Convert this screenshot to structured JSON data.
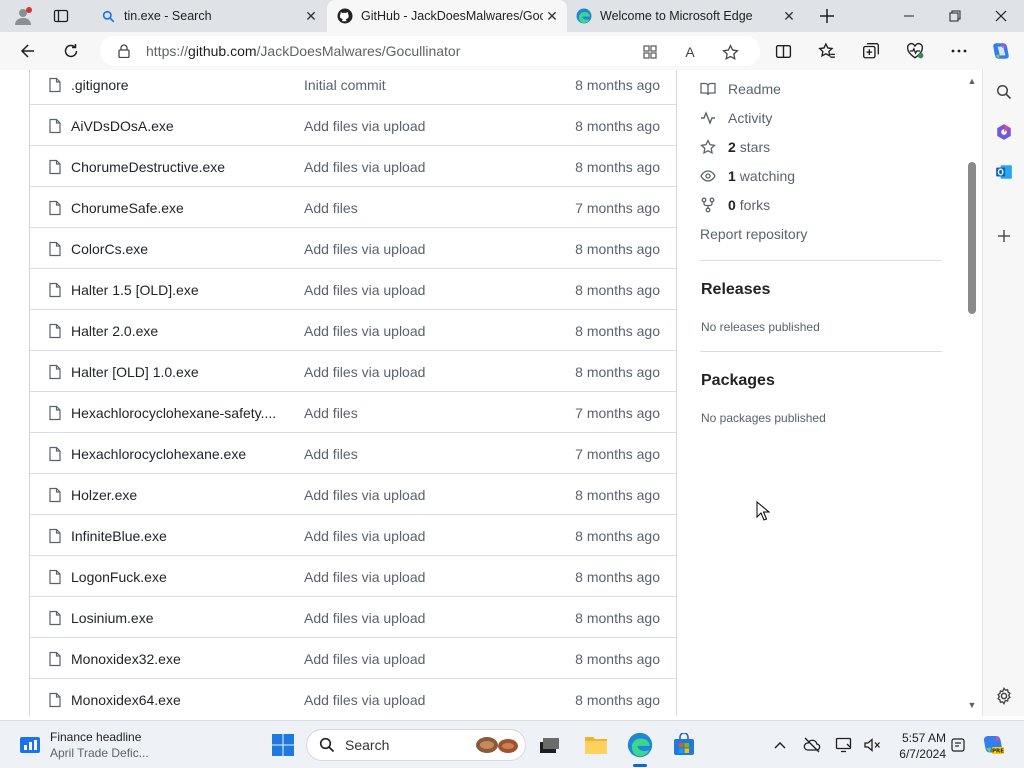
{
  "browser": {
    "tabs": [
      {
        "title": "tin.exe - Search",
        "icon": "search-icon",
        "active": false
      },
      {
        "title": "GitHub - JackDoesMalwares/Goc",
        "icon": "github-icon",
        "active": true
      },
      {
        "title": "Welcome to Microsoft Edge",
        "icon": "edge-icon",
        "active": false
      }
    ],
    "url_prefix": "https://",
    "url_host": "github.com",
    "url_path": "/JackDoesMalwares/Gocullinator",
    "read_aloud_label": "A"
  },
  "files": [
    {
      "name": ".gitignore",
      "message": "Initial commit",
      "date": "8 months ago"
    },
    {
      "name": "AiVDsDOsA.exe",
      "message": "Add files via upload",
      "date": "8 months ago"
    },
    {
      "name": "ChorumeDestructive.exe",
      "message": "Add files via upload",
      "date": "8 months ago"
    },
    {
      "name": "ChorumeSafe.exe",
      "message": "Add files",
      "date": "7 months ago"
    },
    {
      "name": "ColorCs.exe",
      "message": "Add files via upload",
      "date": "8 months ago"
    },
    {
      "name": "Halter 1.5 [OLD].exe",
      "message": "Add files via upload",
      "date": "8 months ago"
    },
    {
      "name": "Halter 2.0.exe",
      "message": "Add files via upload",
      "date": "8 months ago"
    },
    {
      "name": "Halter [OLD] 1.0.exe",
      "message": "Add files via upload",
      "date": "8 months ago"
    },
    {
      "name": "Hexachlorocyclohexane-safety....",
      "message": "Add files",
      "date": "7 months ago"
    },
    {
      "name": "Hexachlorocyclohexane.exe",
      "message": "Add files",
      "date": "7 months ago"
    },
    {
      "name": "Holzer.exe",
      "message": "Add files via upload",
      "date": "8 months ago"
    },
    {
      "name": "InfiniteBlue.exe",
      "message": "Add files via upload",
      "date": "8 months ago"
    },
    {
      "name": "LogonFuck.exe",
      "message": "Add files via upload",
      "date": "8 months ago"
    },
    {
      "name": "Losinium.exe",
      "message": "Add files via upload",
      "date": "8 months ago"
    },
    {
      "name": "Monoxidex32.exe",
      "message": "Add files via upload",
      "date": "8 months ago"
    },
    {
      "name": "Monoxidex64.exe",
      "message": "Add files via upload",
      "date": "8 months ago"
    }
  ],
  "sidebar": {
    "readme": "Readme",
    "activity": "Activity",
    "stars_count": "2",
    "stars_label": "stars",
    "watching_count": "1",
    "watching_label": "watching",
    "forks_count": "0",
    "forks_label": "forks",
    "report": "Report repository",
    "releases_heading": "Releases",
    "releases_note": "No releases published",
    "packages_heading": "Packages",
    "packages_note": "No packages published"
  },
  "taskbar": {
    "widget_title": "Finance headline",
    "widget_subtitle": "April Trade Defic...",
    "search_label": "Search",
    "time": "5:57 AM",
    "date": "6/7/2024"
  },
  "colors": {
    "accent_blue": "#0969da",
    "muted_text": "#59636e",
    "border": "#d0d7de",
    "tabstrip": "#dfe3e8"
  }
}
